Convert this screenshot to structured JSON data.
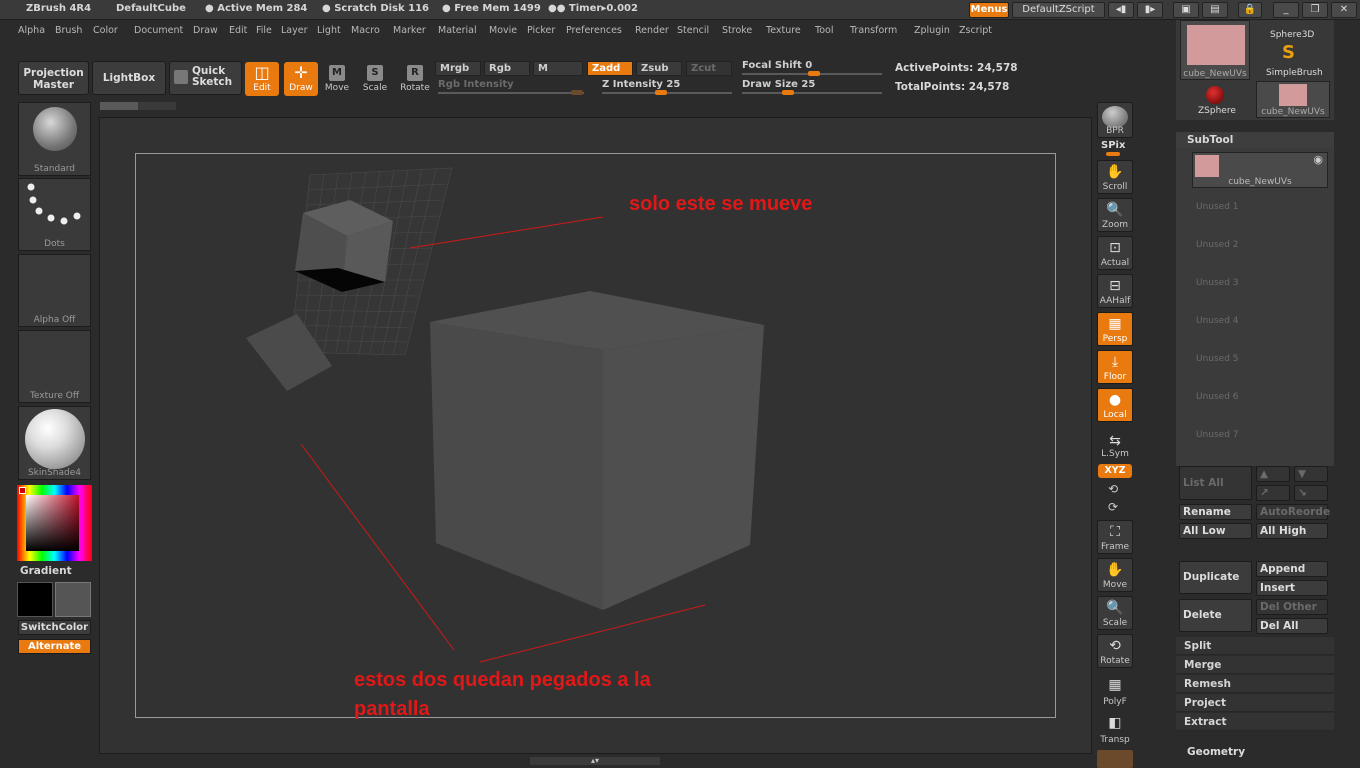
{
  "title": {
    "app": "ZBrush 4R4",
    "doc": "DefaultCube",
    "active_mem": "● Active Mem 284",
    "scratch": "● Scratch Disk 116",
    "free_mem": "● Free Mem 1499",
    "timer": "●● Timer▸0.002",
    "menus_btn": "Menus",
    "zscript_btn": "DefaultZScript"
  },
  "menu": [
    "Alpha",
    "Brush",
    "Color",
    "Document",
    "Draw",
    "Edit",
    "File",
    "Layer",
    "Light",
    "Macro",
    "Marker",
    "Material",
    "Movie",
    "Picker",
    "Preferences",
    "Render",
    "Stencil",
    "Stroke",
    "Texture",
    "Tool",
    "Transform",
    "Zplugin",
    "Zscript"
  ],
  "toolbar": {
    "projection_master": "Projection Master",
    "lightbox": "LightBox",
    "quick_sketch": "Quick Sketch",
    "edit": "Edit",
    "draw": "Draw",
    "move": "Move",
    "scale": "Scale",
    "rotate": "Rotate",
    "mrgb": "Mrgb",
    "rgb": "Rgb",
    "m": "M",
    "zadd": "Zadd",
    "zsub": "Zsub",
    "zcut": "Zcut",
    "rgb_intensity": "Rgb Intensity",
    "z_intensity": "Z Intensity 25",
    "focal_shift": "Focal Shift 0",
    "draw_size": "Draw Size 25",
    "active_points": "ActivePoints: 24,578",
    "total_points": "TotalPoints: 24,578"
  },
  "left": {
    "standard": "Standard",
    "dots": "Dots",
    "alpha": "Alpha Off",
    "texture": "Texture Off",
    "material": "SkinShade4",
    "gradient": "Gradient",
    "switch_color": "SwitchColor",
    "alternate": "Alternate"
  },
  "annotations": {
    "top": "solo este se mueve",
    "bottom_line1": "estos dos quedan pegados a la",
    "bottom_line2": "pantalla"
  },
  "right_shelf": {
    "bpr": "BPR",
    "spix": "SPix",
    "scroll": "Scroll",
    "zoom": "Zoom",
    "actual": "Actual",
    "aahalf": "AAHalf",
    "persp": "Persp",
    "floor": "Floor",
    "local": "Local",
    "lsym": "L.Sym",
    "xyz": "XYZ",
    "frame": "Frame",
    "move": "Move",
    "scale": "Scale",
    "rotate": "Rotate",
    "polyf": "PolyF",
    "transp": "Transp"
  },
  "tool_palette": {
    "cube_label": "cube_NewUVs",
    "sphere3d": "Sphere3D",
    "simplebrush": "SimpleBrush",
    "zsphere": "ZSphere",
    "cube_label2": "cube_NewUVs"
  },
  "subtool": {
    "header": "SubTool",
    "active_name": "cube_NewUVs",
    "unused": [
      "Unused 1",
      "Unused 2",
      "Unused 3",
      "Unused 4",
      "Unused 5",
      "Unused 6",
      "Unused 7"
    ],
    "list_all": "List All",
    "rename": "Rename",
    "auto_reorder": "AutoReorde",
    "all_low": "All Low",
    "all_high": "All High",
    "duplicate": "Duplicate",
    "append": "Append",
    "insert": "Insert",
    "delete": "Delete",
    "del_other": "Del Other",
    "del_all": "Del All",
    "split": "Split",
    "merge": "Merge",
    "remesh": "Remesh",
    "project": "Project",
    "extract": "Extract",
    "geometry": "Geometry"
  },
  "colors": {
    "accent": "#e87a10",
    "annotation": "#e01818",
    "cube": "#555555"
  }
}
